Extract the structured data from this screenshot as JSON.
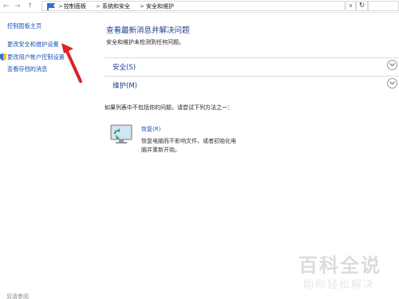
{
  "address_bar": {
    "back": "←",
    "forward": "→",
    "up": "↑",
    "crumbs": [
      "控制面板",
      "系统和安全",
      "安全和维护"
    ],
    "separator": ">",
    "dropdown": "∨",
    "refresh": "↻"
  },
  "left_nav": {
    "items": [
      {
        "label": "控制面板主页"
      },
      {
        "label": "更改安全和维护设置"
      },
      {
        "label": "更改用户帐户控制设置"
      },
      {
        "label": "查看存档的消息"
      }
    ]
  },
  "main": {
    "title": "查看最新消息并解决问题",
    "subtitle": "安全和维护未检测到任何问题。",
    "sections": [
      {
        "label": "安全(S)"
      },
      {
        "label": "维护(M)"
      }
    ],
    "not_found_text": "如果列表中不包括你的问题，请尝试下列方法之一：",
    "recovery": {
      "link": "恢复(R)",
      "description": "恢复电脑而不影响文件，或者初始化电脑并重新开始。"
    }
  },
  "bottom": {
    "text": "另请参阅"
  },
  "watermark": {
    "title": "百科全说",
    "subtitle": "助你轻松解决"
  },
  "colors": {
    "link": "#1a56b3",
    "heading": "#1a3e8c",
    "arrow": "#d9232a"
  }
}
